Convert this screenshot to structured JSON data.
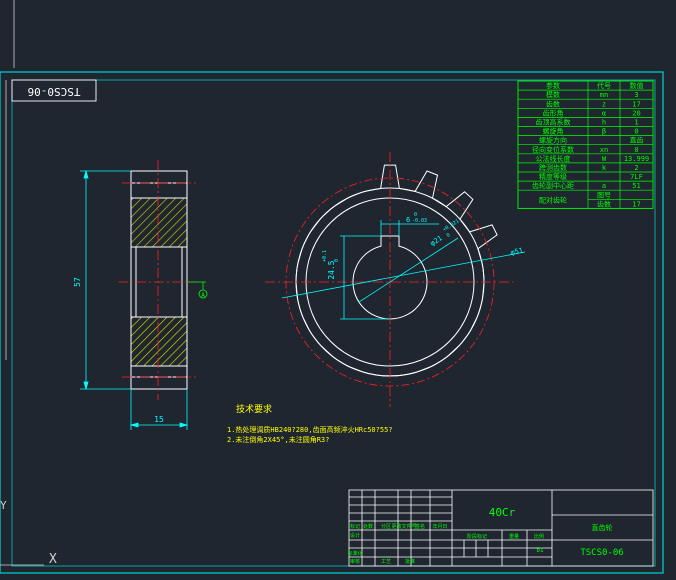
{
  "drawing": {
    "drawing_number_rotated": "TSCS0-06",
    "section_height_dim": "57",
    "section_width_dim": "15",
    "datum_label": "A",
    "keyway_width_dim": "6",
    "keyway_width_tol_upper": "0",
    "keyway_width_tol_lower": "-0.03",
    "bore_depth_dim": "24.5",
    "bore_depth_tol": "+0.1",
    "bore_depth_tol_lower": "0",
    "bore_dim": "φ21",
    "bore_tol_upper": "+0.021",
    "bore_tol_lower": "0",
    "outer_dim": "φ51",
    "tech_title": "技术要求",
    "tech_notes": [
      "1.热处理调质HB240?280,齿面高频淬火HRc50?55?",
      "2.未注倒角2X45°,未注圆角R3?"
    ]
  },
  "param_table": {
    "headers": [
      "参数",
      "代号",
      "数值"
    ],
    "rows": [
      [
        "模数",
        "mn",
        "3"
      ],
      [
        "齿数",
        "z",
        "17"
      ],
      [
        "齿形角",
        "α",
        "20"
      ],
      [
        "齿顶高系数",
        "h",
        "1"
      ],
      [
        "螺旋角",
        "β",
        "0"
      ],
      [
        "螺旋方向",
        "",
        "直齿"
      ],
      [
        "径向变位系数",
        "xn",
        "0"
      ],
      [
        "公法线长度",
        "W",
        "13.999"
      ],
      [
        "跨测齿数",
        "k",
        "2"
      ],
      [
        "精度等级",
        "",
        "7LF"
      ],
      [
        "齿轮副中心距",
        "a",
        "51"
      ]
    ],
    "mating_label": "配对齿轮",
    "mating_rows": [
      [
        "图号",
        ""
      ],
      [
        "齿数",
        "17"
      ]
    ]
  },
  "title_block": {
    "material": "40Cr",
    "part_name": "直齿轮",
    "drawing_number": "TSCS0-06",
    "scale": "b1",
    "small_labels": [
      "标记",
      "处数",
      "分区",
      "更改文件号",
      "签名",
      "年月日",
      "设计",
      "标准化",
      "审核",
      "工艺",
      "批准",
      "阶段标记",
      "重量",
      "比例"
    ]
  },
  "canvas_marks": {
    "y_axis_label": "Y",
    "x_axis_label": "X"
  },
  "colors": {
    "background": "#1f2630",
    "border": "#00c8c8",
    "geometry": "#ffffff",
    "centerline": "#ff2020",
    "dimension": "#00ffff",
    "table_text": "#00ff00",
    "hatch": "#e0e000",
    "note_text": "#ffff00"
  }
}
